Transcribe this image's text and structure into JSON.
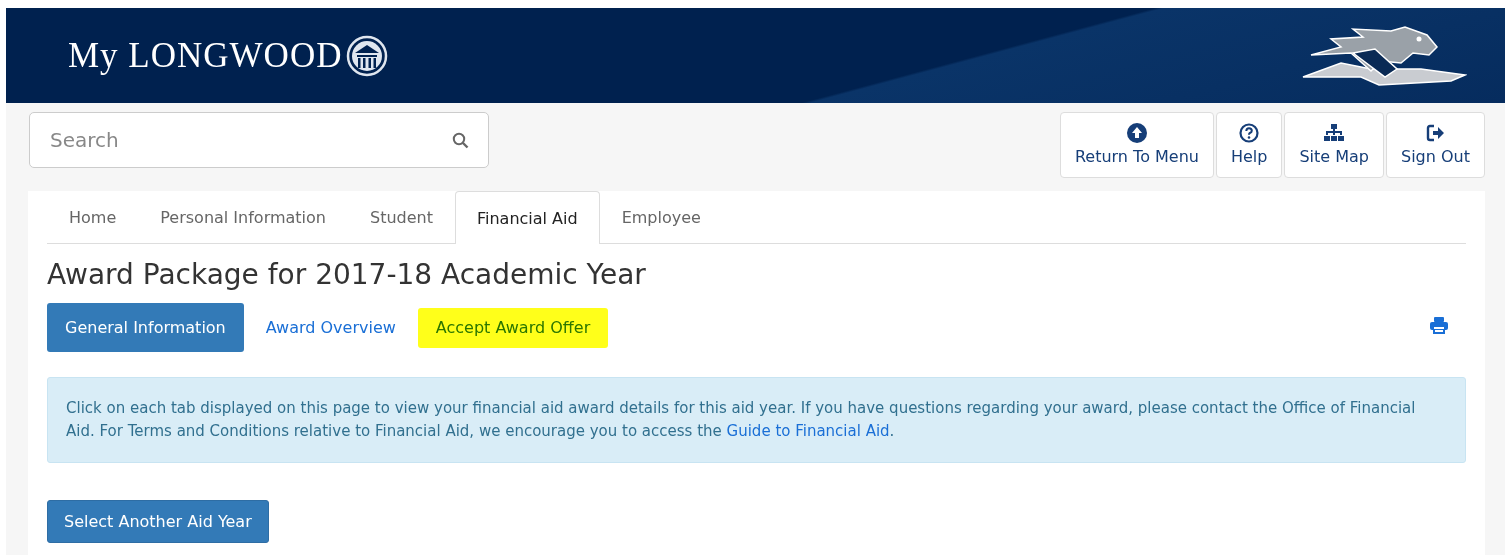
{
  "header": {
    "logo_text": "My LONGWOOD"
  },
  "search": {
    "placeholder": "Search"
  },
  "toolbar": [
    {
      "kind": "up",
      "label": "Return To Menu"
    },
    {
      "kind": "help",
      "label": "Help"
    },
    {
      "kind": "sitemap",
      "label": "Site Map"
    },
    {
      "kind": "signout",
      "label": "Sign Out"
    }
  ],
  "tabs": [
    {
      "label": "Home",
      "selected": false
    },
    {
      "label": "Personal Information",
      "selected": false
    },
    {
      "label": "Student",
      "selected": false
    },
    {
      "label": "Financial Aid",
      "selected": true
    },
    {
      "label": "Employee",
      "selected": false
    }
  ],
  "page_title": "Award Package for 2017-18 Academic Year",
  "section_tabs": [
    {
      "label": "General Information",
      "selected": true,
      "highlighted": false
    },
    {
      "label": "Award Overview",
      "selected": false,
      "highlighted": false
    },
    {
      "label": "Accept Award Offer",
      "selected": false,
      "highlighted": true
    }
  ],
  "info": {
    "text": "Click on each tab displayed on this page to view your financial aid award details for this aid year. If you have questions regarding your award, please contact the Office of Financial Aid. For Terms and Conditions relative to Financial Aid, we encourage you to access the",
    "link": "Guide to Financial Aid",
    "after": "."
  },
  "select_button": "Select Another Aid Year"
}
